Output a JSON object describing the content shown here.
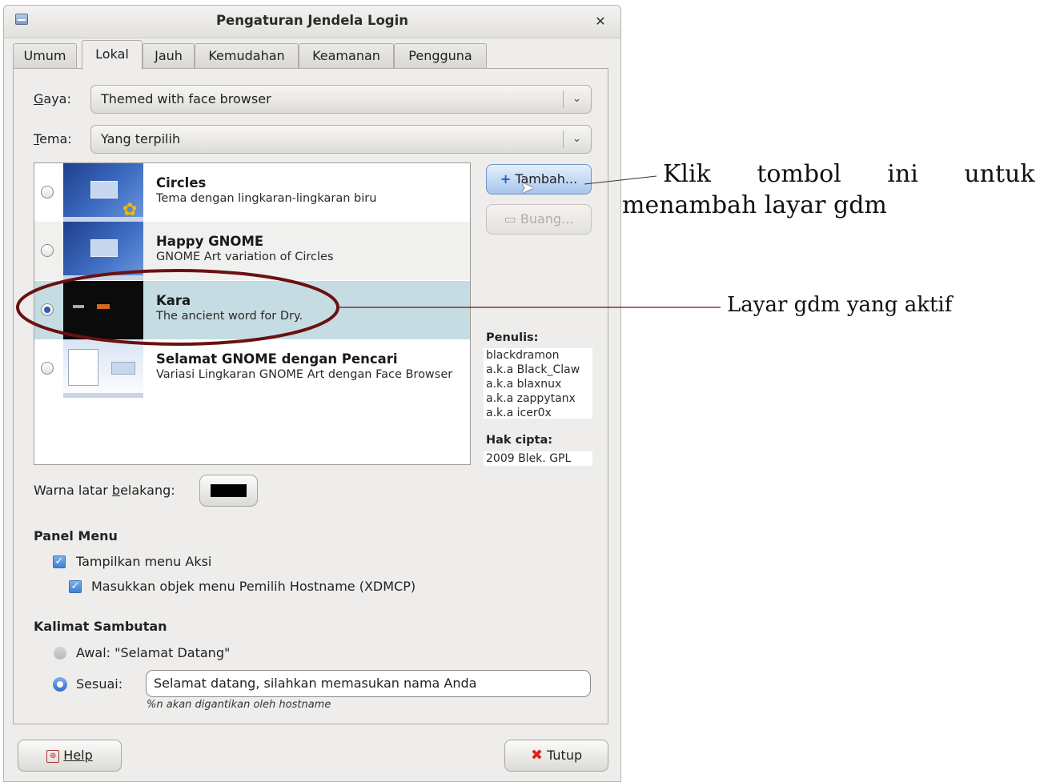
{
  "window": {
    "title": "Pengaturan Jendela Login"
  },
  "tabs": [
    {
      "label": "Umum"
    },
    {
      "label": "Lokal"
    },
    {
      "label": "Jauh"
    },
    {
      "label": "Kemudahan"
    },
    {
      "label": "Keamanan"
    },
    {
      "label": "Pengguna"
    }
  ],
  "active_tab": "Lokal",
  "style": {
    "label": "Gaya:",
    "value": "Themed with face browser"
  },
  "theme": {
    "label": "Tema:",
    "value": "Yang terpilih"
  },
  "themes": [
    {
      "name": "Circles",
      "desc": "Tema dengan lingkaran-lingkaran biru",
      "selected": false
    },
    {
      "name": "Happy GNOME",
      "desc": "GNOME Art variation of Circles",
      "selected": false
    },
    {
      "name": "Kara",
      "desc": "The ancient word for Dry.",
      "selected": true
    },
    {
      "name": "Selamat GNOME dengan Pencari",
      "desc": "Variasi Lingkaran GNOME Art dengan Face Browser",
      "selected": false
    }
  ],
  "buttons": {
    "add": "Tambah...",
    "remove": "Buang...",
    "help": "Help",
    "close": "Tutup"
  },
  "info": {
    "author_label": "Penulis:",
    "authors": [
      "blackdramon",
      "a.k.a Black_Claw",
      "a.k.a blaxnux",
      "a.k.a zappytanx",
      "a.k.a icer0x"
    ],
    "copyright_label": "Hak cipta:",
    "copyright": "2009 Blek. GPL"
  },
  "background_color": {
    "label": "Warna latar belakang:",
    "value": "#000000"
  },
  "panel_menu": {
    "heading": "Panel Menu",
    "show_actions": {
      "label": "Tampilkan menu Aksi",
      "checked": true
    },
    "xdmcp_chooser": {
      "label": "Masukkan objek menu Pemilih Hostname (XDMCP)",
      "checked": true
    }
  },
  "welcome": {
    "heading": "Kalimat Sambutan",
    "default_option": {
      "label": "Awal: \"Selamat Datang\"",
      "selected": false
    },
    "custom_option": {
      "label": "Sesuai:",
      "selected": true
    },
    "custom_value": "Selamat datang, silahkan memasukan nama Anda",
    "hint": "%n akan digantikan oleh hostname"
  },
  "annotations": {
    "add_note_line1": "Klik tombol ini untuk",
    "add_note_line2": "menambah layar gdm",
    "active_note": "Layar gdm yang aktif"
  },
  "colors": {
    "annotation_line": "#6b1010",
    "selected_row": "#c5dde2"
  }
}
